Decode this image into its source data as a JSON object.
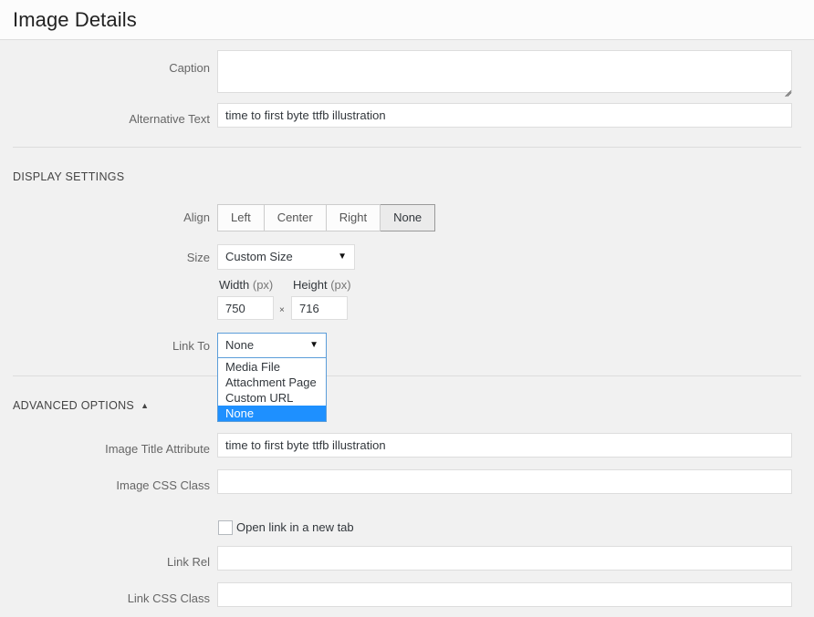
{
  "header": {
    "title": "Image Details"
  },
  "fields": {
    "caption": {
      "label": "Caption",
      "value": ""
    },
    "alt_text": {
      "label": "Alternative Text",
      "value": "time to first byte ttfb illustration"
    },
    "image_title_attribute": {
      "label": "Image Title Attribute",
      "value": "time to first byte ttfb illustration"
    },
    "image_css_class": {
      "label": "Image CSS Class",
      "value": ""
    },
    "link_rel": {
      "label": "Link Rel",
      "value": ""
    },
    "link_css_class": {
      "label": "Link CSS Class",
      "value": ""
    }
  },
  "display_settings": {
    "heading": "DISPLAY SETTINGS",
    "align": {
      "label": "Align",
      "options": [
        "Left",
        "Center",
        "Right",
        "None"
      ],
      "selected": "None"
    },
    "size": {
      "label": "Size",
      "selected": "Custom Size",
      "arrow_icon": "▼"
    },
    "dimensions": {
      "width_label": "Width",
      "width_unit": "(px)",
      "width_value": "750",
      "separator": "×",
      "height_label": "Height",
      "height_unit": "(px)",
      "height_value": "716"
    },
    "link_to": {
      "label": "Link To",
      "selected": "None",
      "arrow_icon": "▼",
      "open": true,
      "options": [
        {
          "label": "Media File",
          "selected": false
        },
        {
          "label": "Attachment Page",
          "selected": false
        },
        {
          "label": "Custom URL",
          "selected": false
        },
        {
          "label": "None",
          "selected": true
        }
      ]
    }
  },
  "advanced_options": {
    "heading": "ADVANCED OPTIONS",
    "toggle_arrow": "▲",
    "open_new_tab": {
      "label": "Open link in a new tab",
      "checked": false
    }
  },
  "colors": {
    "background": "#f1f1f1",
    "header_background": "#fcfcfc",
    "highlight_blue": "#1e90ff",
    "focus_border": "#5b9dd9",
    "label_text": "#666666",
    "value_text": "#32373c"
  }
}
